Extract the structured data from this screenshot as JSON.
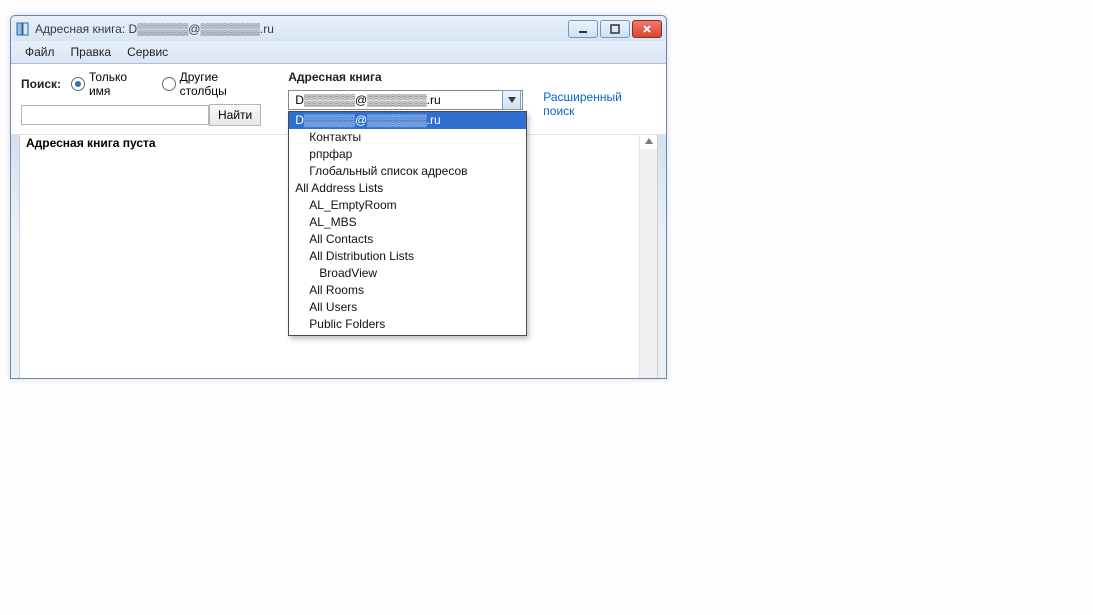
{
  "title": "Адресная книга: D▒▒▒▒▒▒@▒▒▒▒▒▒▒.ru",
  "menus": {
    "file": "Файл",
    "edit": "Правка",
    "service": "Сервис"
  },
  "toolbar": {
    "search_label": "Поиск:",
    "radio_name_only": "Только имя",
    "radio_more_cols": "Другие столбцы",
    "address_book_label": "Адресная книга",
    "find_button": "Найти",
    "combo_value": "D▒▒▒▒▒▒@▒▒▒▒▒▒▒.ru",
    "advanced_search": "Расширенный поиск"
  },
  "dropdown": {
    "items": [
      {
        "label": "D▒▒▒▒▒▒@▒▒▒▒▒▒▒.ru",
        "indent": 0,
        "selected": true
      },
      {
        "label": "Контакты",
        "indent": 1,
        "selected": false
      },
      {
        "label": "рпрфар",
        "indent": 1,
        "selected": false
      },
      {
        "label": "Глобальный список адресов",
        "indent": 1,
        "selected": false
      },
      {
        "label": "All Address Lists",
        "indent": 0,
        "selected": false
      },
      {
        "label": "AL_EmptyRoom",
        "indent": 1,
        "selected": false
      },
      {
        "label": "AL_MBS",
        "indent": 1,
        "selected": false
      },
      {
        "label": "All Contacts",
        "indent": 1,
        "selected": false
      },
      {
        "label": "All Distribution Lists",
        "indent": 1,
        "selected": false
      },
      {
        "label": "BroadView",
        "indent": 2,
        "selected": false
      },
      {
        "label": "All Rooms",
        "indent": 1,
        "selected": false
      },
      {
        "label": "All Users",
        "indent": 1,
        "selected": false
      },
      {
        "label": "Public Folders",
        "indent": 1,
        "selected": false
      }
    ]
  },
  "content": {
    "empty_text": "Адресная книга пуста"
  }
}
